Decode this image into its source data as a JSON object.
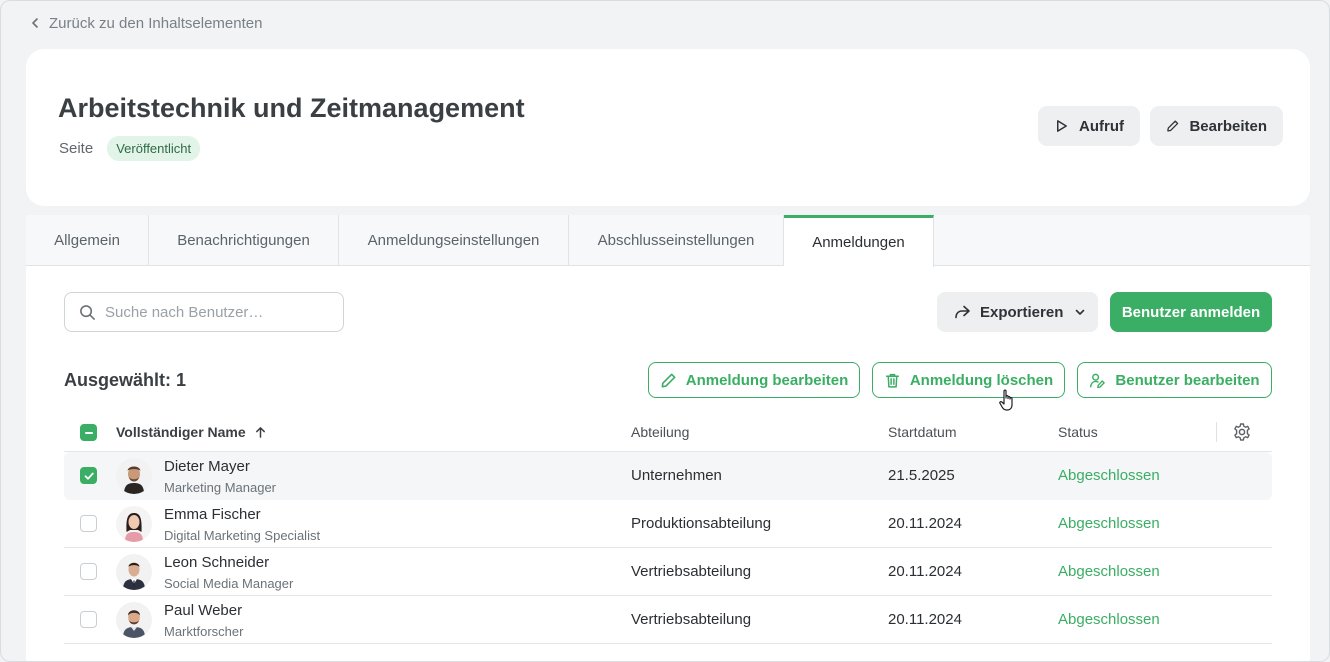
{
  "nav": {
    "back_label": "Zurück zu den Inhaltselementen"
  },
  "header": {
    "title": "Arbeitstechnik und Zeitmanagement",
    "type": "Seite",
    "status_badge": "Veröffentlicht",
    "call_label": "Aufruf",
    "edit_label": "Bearbeiten"
  },
  "tabs": [
    {
      "label": "Allgemein"
    },
    {
      "label": "Benachrichtigungen"
    },
    {
      "label": "Anmeldungseinstellungen"
    },
    {
      "label": "Abschlusseinstellungen"
    },
    {
      "label": "Anmeldungen",
      "active": true
    }
  ],
  "toolbar": {
    "search_placeholder": "Suche nach Benutzer…",
    "export_label": "Exportieren",
    "enroll_label": "Benutzer anmelden"
  },
  "selection": {
    "label": "Ausgewählt: 1",
    "edit_enrollment": "Anmeldung bearbeiten",
    "delete_enrollment": "Anmeldung löschen",
    "edit_user": "Benutzer bearbeiten"
  },
  "table": {
    "columns": {
      "name": "Vollständiger Name",
      "department": "Abteilung",
      "start": "Startdatum",
      "status": "Status"
    },
    "rows": [
      {
        "name": "Dieter Mayer",
        "role": "Marketing Manager",
        "department": "Unternehmen",
        "start": "21.5.2025",
        "status": "Abgeschlossen",
        "checked": true
      },
      {
        "name": "Emma Fischer",
        "role": "Digital Marketing Specialist",
        "department": "Produktionsabteilung",
        "start": "20.11.2024",
        "status": "Abgeschlossen",
        "checked": false
      },
      {
        "name": "Leon Schneider",
        "role": "Social Media Manager",
        "department": "Vertriebsabteilung",
        "start": "20.11.2024",
        "status": "Abgeschlossen",
        "checked": false
      },
      {
        "name": "Paul Weber",
        "role": "Marktforscher",
        "department": "Vertriebsabteilung",
        "start": "20.11.2024",
        "status": "Abgeschlossen",
        "checked": false
      }
    ]
  },
  "colors": {
    "accent": "#3aae64",
    "badge_bg": "#e2f3e8"
  }
}
